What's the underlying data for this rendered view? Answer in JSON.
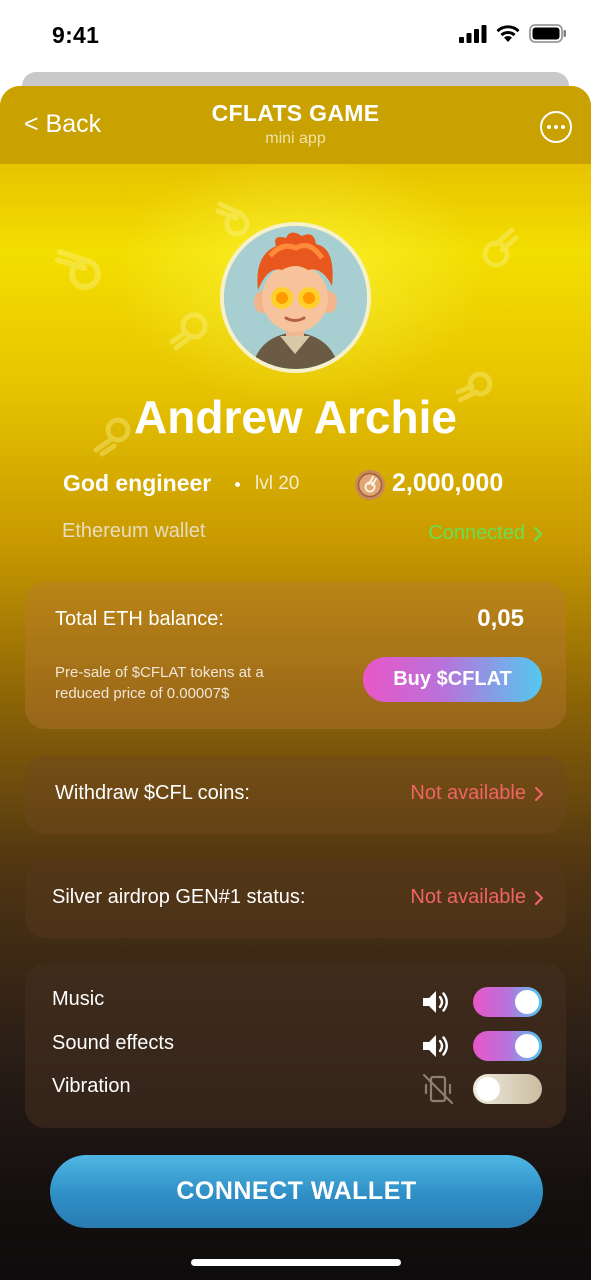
{
  "status_bar": {
    "time": "9:41"
  },
  "header": {
    "back_label": "< Back",
    "title": "CFLATS GAME",
    "subtitle": "mini app"
  },
  "profile": {
    "name": "Andrew Archie",
    "rank": "God engineer",
    "level": "lvl 20",
    "coins": "2,000,000",
    "wallet_label": "Ethereum wallet",
    "wallet_status": "Connected"
  },
  "balance_card": {
    "label": "Total ETH balance:",
    "value": "0,05",
    "presale_text": "Pre-sale of $CFLAT tokens at a reduced price of 0.00007$",
    "buy_label": "Buy $CFLAT"
  },
  "withdraw": {
    "label": "Withdraw $CFL coins:",
    "status": "Not available"
  },
  "airdrop": {
    "label": "Silver airdrop GEN#1 status:",
    "status": "Not available"
  },
  "settings": [
    {
      "label": "Music",
      "icon": "speaker-icon",
      "enabled": true
    },
    {
      "label": "Sound effects",
      "icon": "speaker-icon",
      "enabled": true
    },
    {
      "label": "Vibration",
      "icon": "vibration-off-icon",
      "enabled": false
    }
  ],
  "connect_label": "CONNECT WALLET",
  "colors": {
    "connected": "#68e050",
    "not_available": "#f06464",
    "toggle_gradient_start": "#e956c7",
    "toggle_gradient_end": "#54c8ef",
    "connect_button": "#3a9dd2"
  }
}
